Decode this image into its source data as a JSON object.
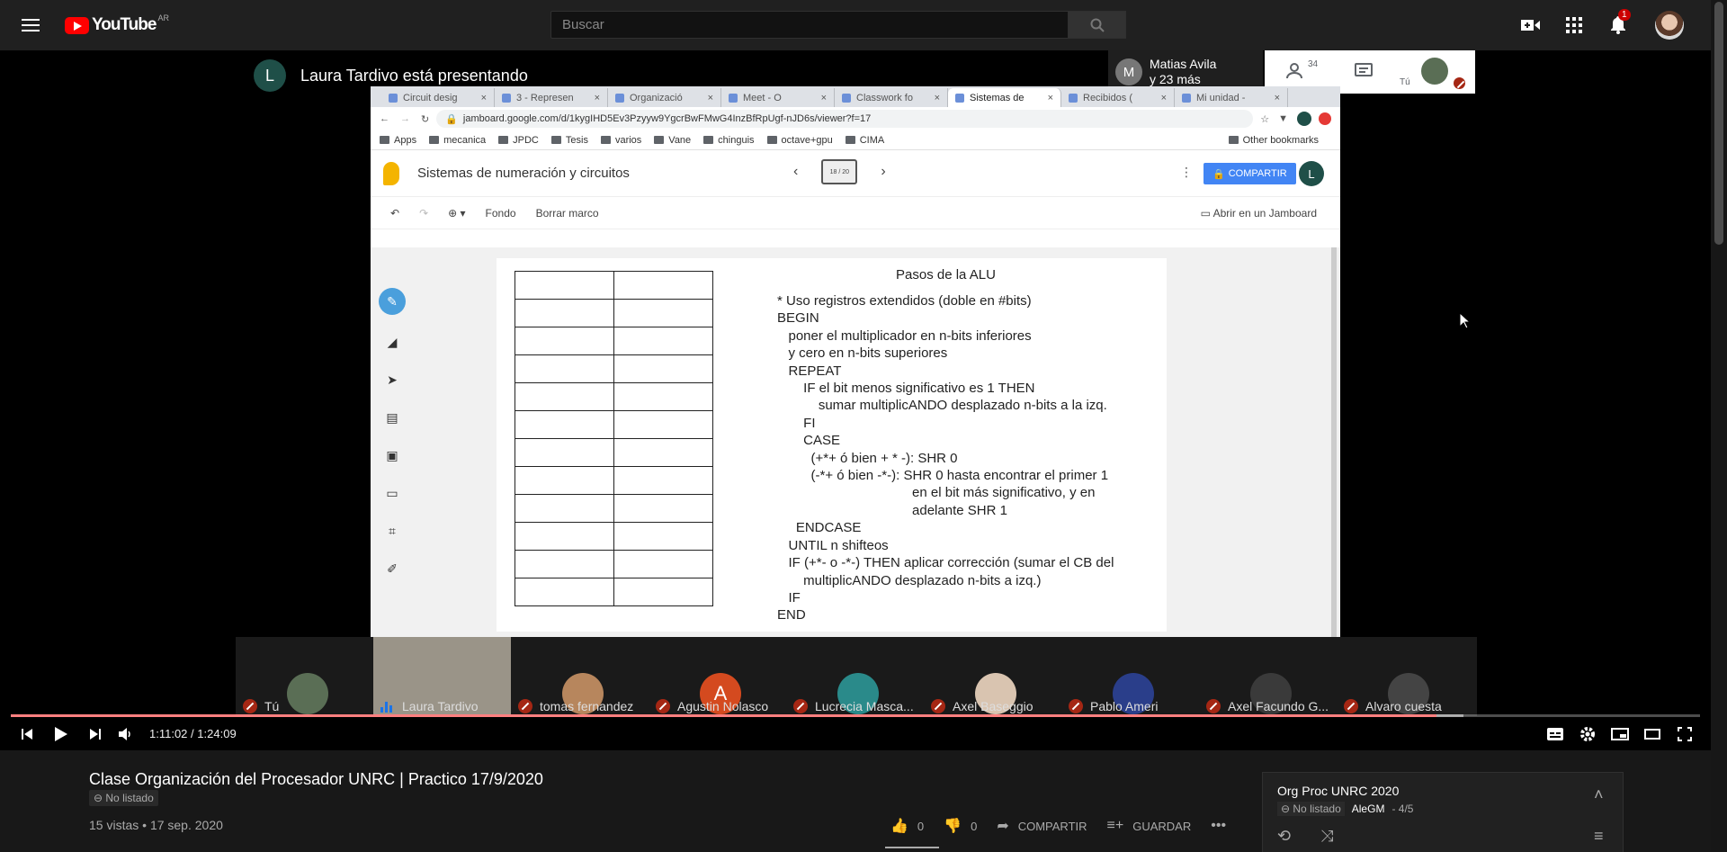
{
  "masthead": {
    "logo_text": "YouTube",
    "country": "AR",
    "search_placeholder": "Buscar",
    "notifications_count": "1"
  },
  "meet": {
    "presenter_initial": "L",
    "presenter_text": "Laura Tardivo está presentando",
    "others_initial": "M",
    "others_name": "Matias Avila",
    "others_more": "y 23 más",
    "people_count": "34",
    "self_label": "Tú"
  },
  "browser": {
    "tabs": [
      {
        "label": "Circuit desig",
        "active": false
      },
      {
        "label": "3 - Represen",
        "active": false
      },
      {
        "label": "Organizació",
        "active": false
      },
      {
        "label": "Meet - O",
        "active": false
      },
      {
        "label": "Classwork fo",
        "active": false
      },
      {
        "label": "Sistemas de",
        "active": true
      },
      {
        "label": "Recibidos (",
        "active": false
      },
      {
        "label": "Mi unidad -",
        "active": false
      }
    ],
    "url": "jamboard.google.com/d/1kygIHD5Ev3Pzyyw9YgcrBwFMwG4InzBfRpUgf-nJD6s/viewer?f=17",
    "bookmarks": [
      "Apps",
      "mecanica",
      "JPDC",
      "Tesis",
      "varios",
      "Vane",
      "chinguis",
      "octave+gpu",
      "CIMA"
    ],
    "other_bookmarks": "Other bookmarks"
  },
  "jamboard": {
    "title": "Sistemas de numeración y circuitos",
    "frame_indicator": "18 / 20",
    "share_label": "COMPARTIR",
    "user_initial": "L",
    "toolbar": {
      "fondo": "Fondo",
      "borrar": "Borrar marco",
      "abrir": "Abrir en un Jamboard"
    },
    "alu_title": "Pasos de la ALU",
    "alu_lines": [
      "* Uso registros extendidos (doble en #bits)",
      "BEGIN",
      "   poner el multiplicador en n-bits inferiores",
      "   y cero en n-bits superiores",
      "   REPEAT",
      "       IF el bit menos significativo es 1 THEN",
      "           sumar multiplicANDO desplazado n-bits a la izq.",
      "       FI",
      "       CASE",
      "         (+*+ ó bien + * -): SHR 0",
      "         (-*+ ó bien -*-): SHR 0 hasta encontrar el primer 1",
      "                                    en el bit más significativo, y en",
      "                                    adelante SHR 1",
      "     ENDCASE",
      "   UNTIL n shifteos",
      "   IF (+*- o -*-) THEN aplicar corrección (sumar el CB del",
      "       multiplicANDO desplazado n-bits a izq.)",
      "   IF",
      "END"
    ],
    "table_rows": 12
  },
  "participants": [
    {
      "name": "Tú",
      "muted": true,
      "color": "#5a6e55",
      "initial": ""
    },
    {
      "name": "Laura Tardivo",
      "muted": false,
      "color": "#9a9488",
      "initial": ""
    },
    {
      "name": "tomas fernandez",
      "muted": true,
      "color": "#b7865d",
      "initial": ""
    },
    {
      "name": "Agustin Nolasco",
      "muted": true,
      "color": "#d44a1f",
      "initial": "A"
    },
    {
      "name": "Lucrecia Masca...",
      "muted": true,
      "color": "#2a8a8a",
      "initial": ""
    },
    {
      "name": "Axel Baseggio",
      "muted": true,
      "color": "#d9c4b0",
      "initial": ""
    },
    {
      "name": "Pablo Ameri",
      "muted": true,
      "color": "#2a3e8a",
      "initial": ""
    },
    {
      "name": "Axel Facundo G...",
      "muted": true,
      "color": "#3a3a3a",
      "initial": ""
    },
    {
      "name": "Alvaro cuesta",
      "muted": true,
      "color": "#444444",
      "initial": ""
    }
  ],
  "player": {
    "time_current": "1:11:02",
    "time_separator": "/",
    "time_total": "1:24:09",
    "progress_played": 0.844,
    "progress_loaded": 0.86
  },
  "video": {
    "title": "Clase Organización del Procesador UNRC | Practico 17/9/2020",
    "privacy": "No listado",
    "views": "15 vistas",
    "separator": "•",
    "date": "17 sep. 2020",
    "likes": "0",
    "dislikes": "0",
    "share_label": "COMPARTIR",
    "save_label": "GUARDAR"
  },
  "playlist": {
    "title": "Org Proc UNRC 2020",
    "privacy": "No listado",
    "owner": "AleGM",
    "position": "- 4/5"
  }
}
